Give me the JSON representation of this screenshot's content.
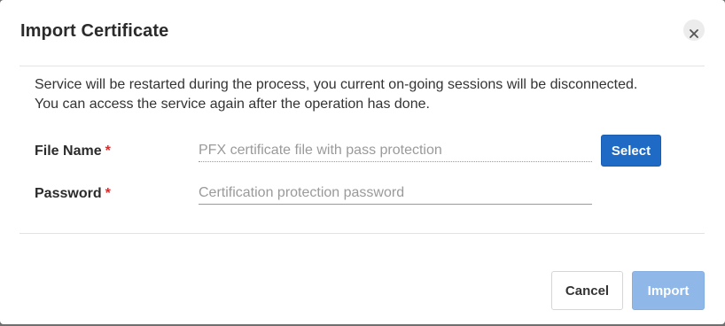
{
  "dialog": {
    "title": "Import Certificate",
    "close_icon": "close-icon",
    "message_lines": [
      "Service will be restarted during the process, you current on-going sessions will be disconnected.",
      "You can access the service again after the operation has done."
    ]
  },
  "form": {
    "file_name": {
      "label": "File Name",
      "required_mark": "*",
      "value": "",
      "placeholder": "PFX certificate file with pass protection"
    },
    "password": {
      "label": "Password",
      "required_mark": "*",
      "value": "",
      "placeholder": "Certification protection password"
    },
    "select_label": "Select"
  },
  "footer": {
    "cancel_label": "Cancel",
    "import_label": "Import",
    "import_disabled": true
  },
  "colors": {
    "primary": "#1f6ac5",
    "primary_disabled": "#8fb8e8",
    "required": "#d32f2f",
    "text": "#333333",
    "placeholder": "#9a9a9a"
  }
}
